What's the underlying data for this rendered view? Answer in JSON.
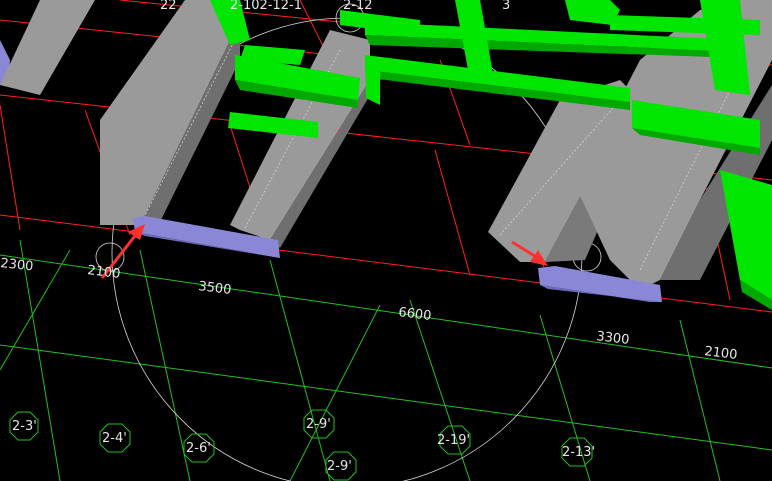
{
  "colors": {
    "background": "#000000",
    "grid_red": "#ff2020",
    "grid_green": "#22c022",
    "column_gray": "#9a9a9a",
    "column_gray_dark": "#6f6f6f",
    "beam_green": "#00e600",
    "beam_green_dark": "#00a800",
    "footing_blue": "#8a88d6",
    "arrow_red": "#ff3030",
    "label_white": "#e6e6e6"
  },
  "dimensions": [
    "2300",
    "2100",
    "3500",
    "6600",
    "3300",
    "2100"
  ],
  "axis_labels": [
    "2-3'",
    "2-4'",
    "2-6'",
    "2-9'",
    "2-9'",
    "2-19'",
    "2-13'"
  ],
  "top_labels": [
    "22",
    "2-102-12-1",
    "2-12",
    "3"
  ],
  "icons": [
    "arrow-icon",
    "arrow-icon"
  ]
}
